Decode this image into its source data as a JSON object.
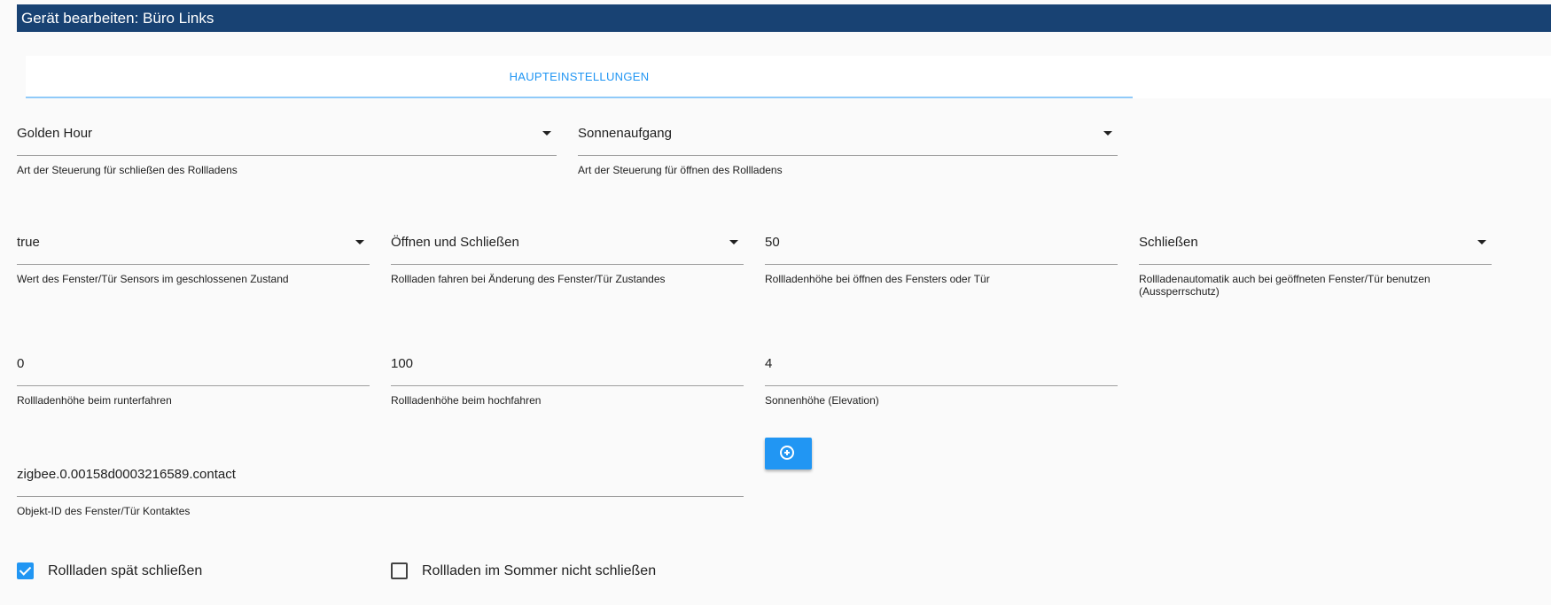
{
  "header": {
    "title": "Gerät bearbeiten: Büro Links"
  },
  "tabs": [
    {
      "label": "HAUPTEINSTELLUNGEN"
    }
  ],
  "fields": {
    "close_type": {
      "value": "Golden Hour",
      "help": "Art der Steuerung für schließen des Rollladens"
    },
    "open_type": {
      "value": "Sonnenaufgang",
      "help": "Art der Steuerung für öffnen des Rollladens"
    },
    "window_sensor_value": {
      "value": "true",
      "help": "Wert des Fenster/Tür Sensors im geschlossenen Zustand"
    },
    "window_change_action": {
      "value": "Öffnen und Schließen",
      "help": "Rollladen fahren bei Änderung des Fenster/Tür Zustandes"
    },
    "window_open_height": {
      "value": "50",
      "help": "Rollladenhöhe bei öffnen des Fensters oder Tür"
    },
    "lockout_protection": {
      "value": "Schließen",
      "help": "Rollladenautomatik auch bei geöffneten Fenster/Tür benutzen (Aussperrschutz)"
    },
    "height_down": {
      "value": "0",
      "help": "Rollladenhöhe beim runterfahren"
    },
    "height_up": {
      "value": "100",
      "help": "Rollladenhöhe beim hochfahren"
    },
    "sun_elevation": {
      "value": "4",
      "help": "Sonnenhöhe (Elevation)"
    },
    "contact_object_id": {
      "value": "zigbee.0.00158d0003216589.contact",
      "help": "Objekt-ID des Fenster/Tür Kontaktes"
    }
  },
  "add_button": {
    "icon": "add-circle-icon"
  },
  "checkboxes": [
    {
      "label": "Rollladen spät schließen",
      "checked": true
    },
    {
      "label": "Rollladen im Sommer nicht schließen",
      "checked": false
    }
  ],
  "colors": {
    "header_bg": "#184273",
    "accent": "#2196f3"
  }
}
